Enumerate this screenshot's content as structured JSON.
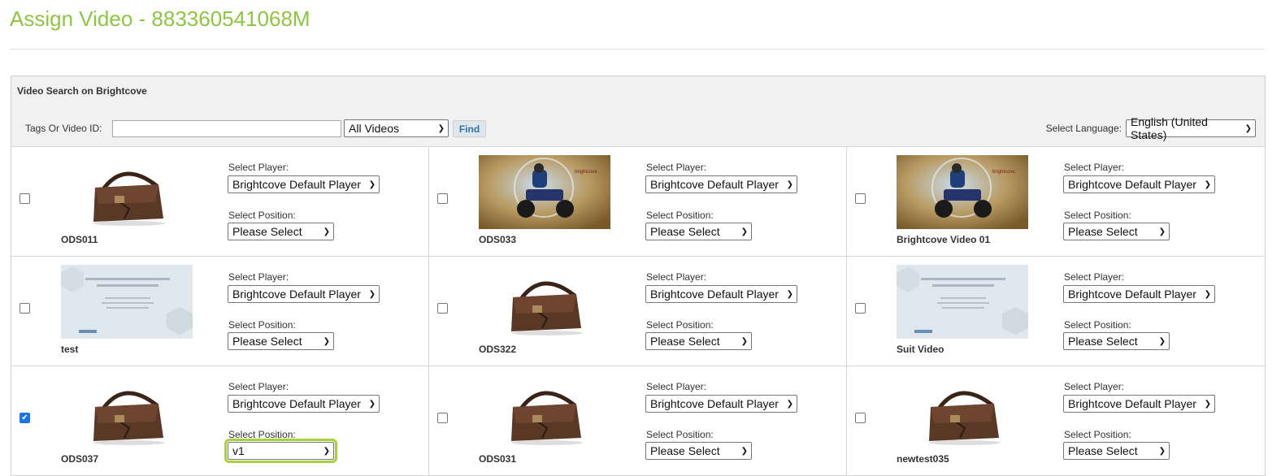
{
  "page": {
    "title": "Assign Video - 883360541068M"
  },
  "search": {
    "heading": "Video Search on Brightcove",
    "label": "Tags Or Video ID:",
    "input_value": "",
    "filter_value": "All Videos",
    "find_label": "Find",
    "language_label": "Select Language:",
    "language_value": "English (United States)"
  },
  "labels": {
    "player": "Select Player:",
    "position": "Select Position:"
  },
  "colors": {
    "title": "#8dc63f",
    "highlight": "#a8d13a",
    "find_text": "#2f73a8"
  },
  "videos": [
    {
      "name": "ODS011",
      "thumb": "bag-icon",
      "player": "Brightcove Default Player",
      "position": "Please Select",
      "checked": false
    },
    {
      "name": "ODS033",
      "thumb": "atv-icon",
      "player": "Brightcove Default Player",
      "position": "Please Select",
      "checked": false
    },
    {
      "name": "Brightcove Video 01",
      "thumb": "atv-icon",
      "player": "Brightcove Default Player",
      "position": "Please Select",
      "checked": false
    },
    {
      "name": "test",
      "thumb": "slide-icon",
      "player": "Brightcove Default Player",
      "position": "Please Select",
      "checked": false
    },
    {
      "name": "ODS322",
      "thumb": "bag-icon",
      "player": "Brightcove Default Player",
      "position": "Please Select",
      "checked": false
    },
    {
      "name": "Suit Video",
      "thumb": "slide-icon",
      "player": "Brightcove Default Player",
      "position": "Please Select",
      "checked": false
    },
    {
      "name": "ODS037",
      "thumb": "bag-icon",
      "player": "Brightcove Default Player",
      "position": "v1",
      "checked": true,
      "highlight": true
    },
    {
      "name": "ODS031",
      "thumb": "bag-icon",
      "player": "Brightcove Default Player",
      "position": "Please Select",
      "checked": false
    },
    {
      "name": "newtest035",
      "thumb": "bag-icon",
      "player": "Brightcove Default Player",
      "position": "Please Select",
      "checked": false
    }
  ]
}
